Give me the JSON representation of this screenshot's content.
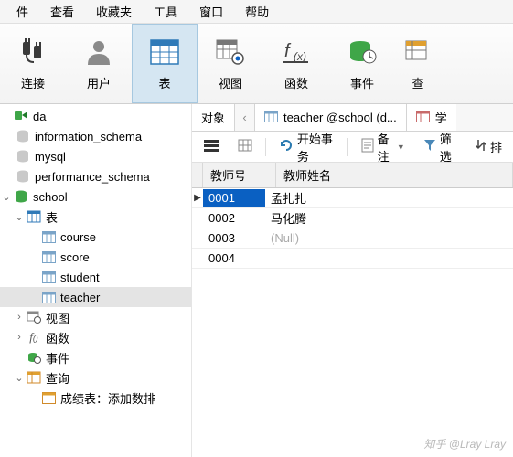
{
  "menu": {
    "items": [
      "件",
      "查看",
      "收藏夹",
      "工具",
      "窗口",
      "帮助"
    ]
  },
  "toolbar": {
    "connect": "连接",
    "user": "用户",
    "table": "表",
    "view": "视图",
    "function": "函数",
    "event": "事件",
    "query": "查"
  },
  "tree": {
    "da": "da",
    "info_schema": "information_schema",
    "mysql": "mysql",
    "perf_schema": "performance_schema",
    "school": "school",
    "tables_label": "表",
    "tables": [
      "course",
      "score",
      "student",
      "teacher"
    ],
    "views": "视图",
    "functions": "函数",
    "events": "事件",
    "queries": "查询",
    "query_item": "成绩表：添加数排"
  },
  "tabs": {
    "objects": "对象",
    "teacher": "teacher @school (d...",
    "student_partial": "学"
  },
  "actions": {
    "begin_tx": "开始事务",
    "memo": "备注",
    "filter": "筛选",
    "sort": "排"
  },
  "grid": {
    "headers": {
      "c1": "教师号",
      "c2": "教师姓名"
    },
    "rows": [
      {
        "id": "0001",
        "name": "孟扎扎",
        "selected": true
      },
      {
        "id": "0002",
        "name": "马化腾"
      },
      {
        "id": "0003",
        "name": "(Null)",
        "null": true
      },
      {
        "id": "0004",
        "name": ""
      }
    ]
  },
  "watermark": "知乎 @Lray Lray"
}
